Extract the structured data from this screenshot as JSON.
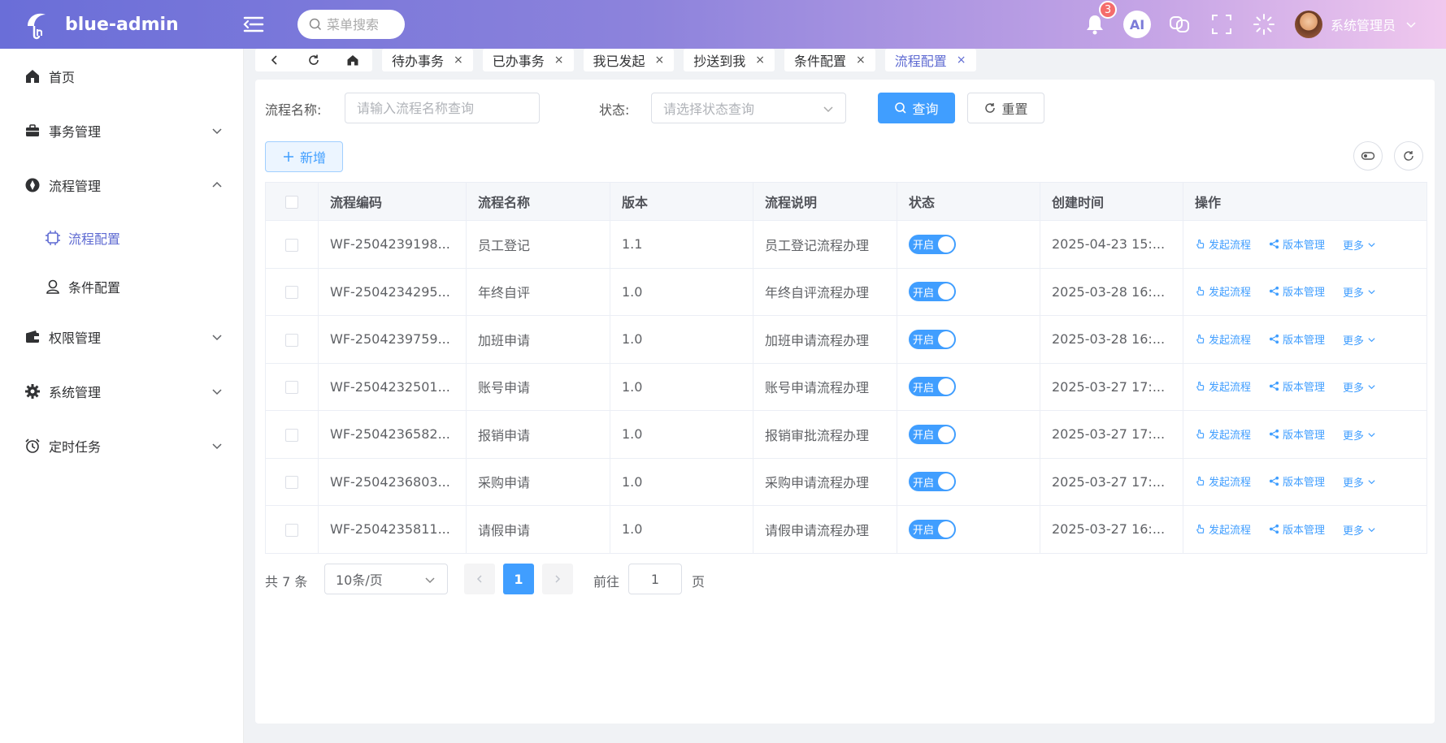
{
  "header": {
    "brand": "blue-admin",
    "search_placeholder": "菜单搜索",
    "notification_count": "3",
    "ai_label": "AI",
    "username": "系统管理员"
  },
  "sidebar": {
    "items": [
      {
        "label": "首页"
      },
      {
        "label": "事务管理"
      },
      {
        "label": "流程管理"
      },
      {
        "label": "流程配置"
      },
      {
        "label": "条件配置"
      },
      {
        "label": "权限管理"
      },
      {
        "label": "系统管理"
      },
      {
        "label": "定时任务"
      }
    ]
  },
  "tabs": [
    {
      "label": "待办事务"
    },
    {
      "label": "已办事务"
    },
    {
      "label": "我已发起"
    },
    {
      "label": "抄送到我"
    },
    {
      "label": "条件配置"
    },
    {
      "label": "流程配置"
    }
  ],
  "tab_close": "×",
  "filters": {
    "name_label": "流程名称:",
    "name_placeholder": "请输入流程名称查询",
    "status_label": "状态:",
    "status_placeholder": "请选择状态查询",
    "search_button": "查询",
    "reset_button": "重置",
    "add_button": "新增"
  },
  "table": {
    "columns": [
      "流程编码",
      "流程名称",
      "版本",
      "流程说明",
      "状态",
      "创建时间",
      "操作"
    ],
    "switch_label": "开启",
    "action_start": "发起流程",
    "action_version": "版本管理",
    "action_more": "更多",
    "rows": [
      {
        "code": "WF-2504239198...",
        "name": "员工登记",
        "version": "1.1",
        "desc": "员工登记流程办理",
        "created": "2025-04-23 15:..."
      },
      {
        "code": "WF-2504234295...",
        "name": "年终自评",
        "version": "1.0",
        "desc": "年终自评流程办理",
        "created": "2025-03-28 16:..."
      },
      {
        "code": "WF-2504239759...",
        "name": "加班申请",
        "version": "1.0",
        "desc": "加班申请流程办理",
        "created": "2025-03-28 16:..."
      },
      {
        "code": "WF-2504232501...",
        "name": "账号申请",
        "version": "1.0",
        "desc": "账号申请流程办理",
        "created": "2025-03-27 17:..."
      },
      {
        "code": "WF-2504236582...",
        "name": "报销申请",
        "version": "1.0",
        "desc": "报销审批流程办理",
        "created": "2025-03-27 17:..."
      },
      {
        "code": "WF-2504236803...",
        "name": "采购申请",
        "version": "1.0",
        "desc": "采购申请流程办理",
        "created": "2025-03-27 17:..."
      },
      {
        "code": "WF-2504235811...",
        "name": "请假申请",
        "version": "1.0",
        "desc": "请假申请流程办理",
        "created": "2025-03-27 16:..."
      }
    ]
  },
  "pagination": {
    "total": "共 7 条",
    "page_size": "10条/页",
    "current_page": "1",
    "goto_label": "前往",
    "goto_value": "1",
    "page_suffix": "页"
  },
  "colors": {
    "primary": "#409eff",
    "accent": "#5e6ad2",
    "badge": "#f56c6c"
  }
}
